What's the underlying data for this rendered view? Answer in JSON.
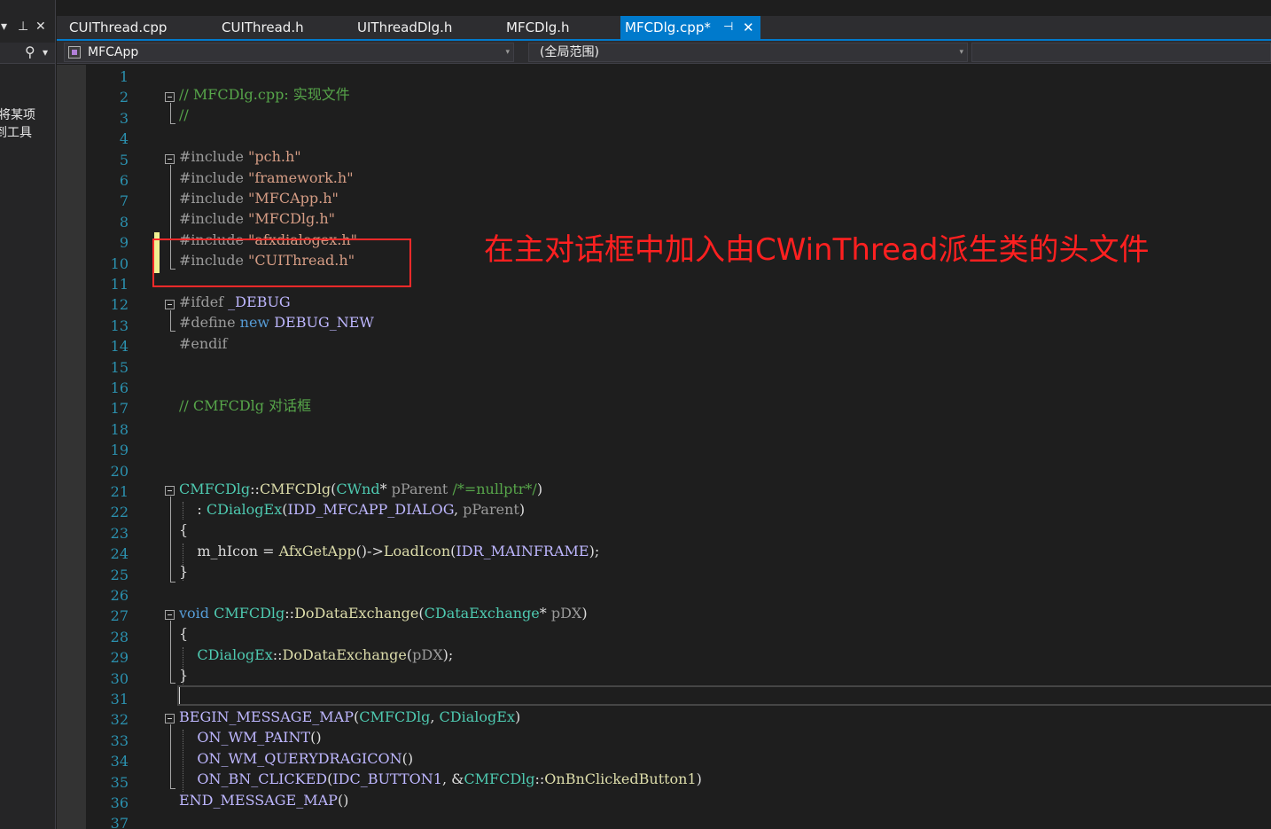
{
  "left_panel": {
    "header_glyphs": {
      "dropdown": "▾",
      "pin": "⊥",
      "close": "✕"
    },
    "search_glyphs": {
      "search": "⚲",
      "dropdown": "▾"
    },
    "text_lines": [
      "将某项",
      "到工具"
    ]
  },
  "tabs": [
    {
      "label": "CUIThread.cpp"
    },
    {
      "label": "CUIThread.h"
    },
    {
      "label": "UIThreadDlg.h"
    },
    {
      "label": "MFCDlg.h"
    },
    {
      "label": "MFCDlg.cpp*",
      "pin": "⊣",
      "close": "✕"
    }
  ],
  "nav": {
    "project": "MFCApp",
    "scope": "(全局范围)",
    "arrow": "▾"
  },
  "editor": {
    "line_numbers": [
      "1",
      "2",
      "3",
      "4",
      "5",
      "6",
      "7",
      "8",
      "9",
      "10",
      "11",
      "12",
      "13",
      "14",
      "15",
      "16",
      "17",
      "18",
      "19",
      "20",
      "21",
      "22",
      "23",
      "24",
      "25",
      "26",
      "27",
      "28",
      "29",
      "30",
      "31",
      "32",
      "33",
      "34",
      "35",
      "36",
      "37"
    ],
    "code": {
      "l2_comment": "// MFCDlg.cpp: 实现文件",
      "l3_comment": "//",
      "include": "#include",
      "l5_file": "\"pch.h\"",
      "l6_file": "\"framework.h\"",
      "l7_file": "\"MFCApp.h\"",
      "l8_file": "\"MFCDlg.h\"",
      "l9_file": "\"afxdialogex.h\"",
      "l10_file": "\"CUIThread.h\"",
      "l12_ifdef": "#ifdef",
      "l12_macro": "_DEBUG",
      "l13_define": "#define",
      "l13_new": "new",
      "l13_macro": "DEBUG_NEW",
      "l14_endif": "#endif",
      "l17_comment": "// CMFCDlg 对话框",
      "class_name": "CMFCDlg",
      "scope_op": "::",
      "ctor_name": "CMFCDlg",
      "open_paren": "(",
      "close_paren": ")",
      "cwnd": "CWnd",
      "star": "*",
      "p_parent": "pParent",
      "default_comment": "/*=nullptr*/",
      "init_colon": ": ",
      "cdialogex": "CDialogEx",
      "idd_macro": "IDD_MFCAPP_DIALOG",
      "comma": ", ",
      "open_brace": "{",
      "close_brace": "}",
      "m_hicon": "m_hIcon",
      "assign": " = ",
      "afxgetapp": "AfxGetApp",
      "arrow_op": "()->",
      "loadicon": "LoadIcon",
      "idr_macro": "IDR_MAINFRAME",
      "semicolon": ";",
      "void_kw": "void",
      "dde_name": "DoDataExchange",
      "cdataexchange": "CDataExchange",
      "p_dx": "pDX",
      "bmm": "BEGIN_MESSAGE_MAP",
      "on_paint": "ON_WM_PAINT",
      "on_qdi": "ON_WM_QUERYDRAGICON",
      "on_bn": "ON_BN_CLICKED",
      "idc_button": "IDC_BUTTON1",
      "amp": "&",
      "handler": "OnBnClickedButton1",
      "call_parens": "()",
      "emm": "END_MESSAGE_MAP"
    }
  },
  "annotation": {
    "text": "在主对话框中加入由CWinThread派生类的头文件",
    "color": "#ff2020"
  },
  "colors": {
    "accent": "#007acc",
    "background": "#1e1e1e",
    "comment": "#57a64a",
    "string": "#d69d85",
    "keyword": "#569cd6",
    "type": "#4ec9b0",
    "macro": "#beb7ff",
    "function": "#dcdcaa",
    "line_number": "#2b91af"
  }
}
